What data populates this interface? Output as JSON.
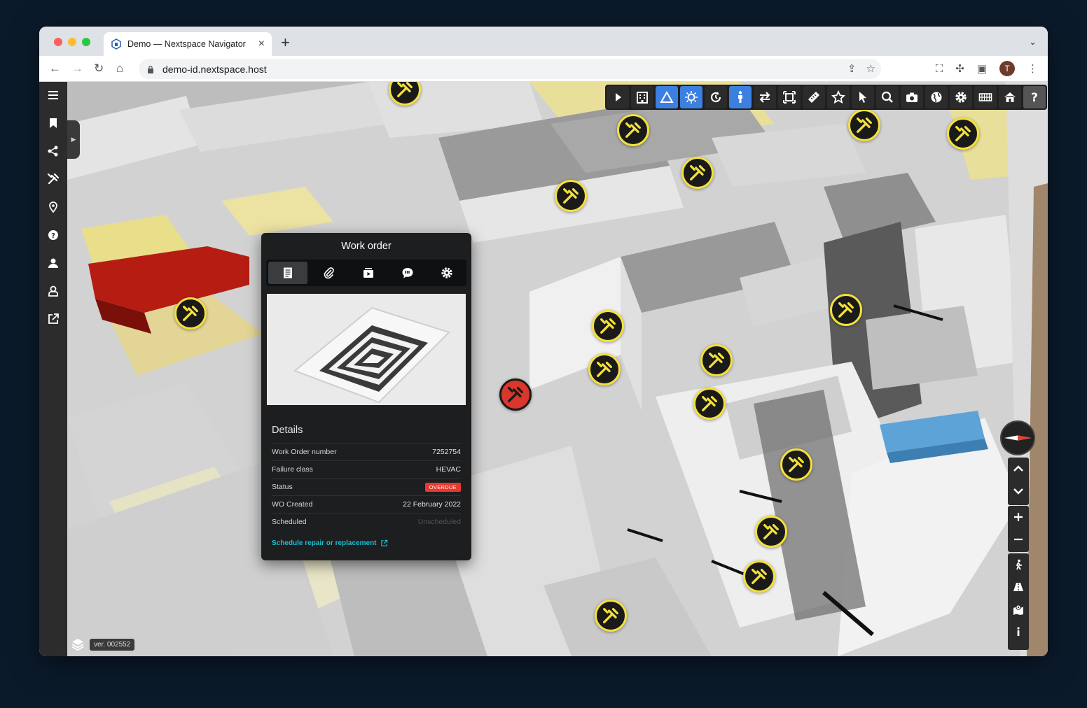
{
  "browser": {
    "tab_title": "Demo — Nextspace Navigator",
    "url": "demo-id.nextspace.host",
    "profile_initial": "T"
  },
  "app": {
    "version": "ver. 002552"
  },
  "work_order": {
    "title": "Work order",
    "details_heading": "Details",
    "rows": [
      {
        "label": "Work Order number",
        "value": "7252754"
      },
      {
        "label": "Failure class",
        "value": "HEVAC"
      },
      {
        "label": "Status",
        "value": "OVERDUE"
      },
      {
        "label": "WO Created",
        "value": "22 February 2022"
      },
      {
        "label": "Scheduled",
        "value": "Unscheduled"
      }
    ],
    "link": "Schedule repair or replacement"
  },
  "colors": {
    "accent": "#3b7fe0",
    "marker_yellow": "#f4e03c",
    "overdue_red": "#e8392f",
    "link_cyan": "#17c3d6"
  }
}
